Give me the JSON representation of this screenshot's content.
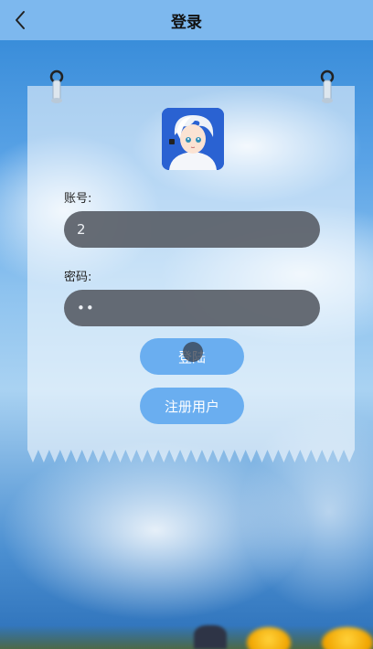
{
  "topbar": {
    "title": "登录",
    "back_icon": "chevron-left-icon",
    "background": "#7db8ee"
  },
  "form": {
    "account_label": "账号:",
    "account_value": "2",
    "password_label": "密码:",
    "password_value": "••"
  },
  "buttons": {
    "login_label": "登陆",
    "register_label": "注册用户",
    "color": "#6aaef0"
  },
  "avatar": {
    "icon": "anime-avatar-icon"
  }
}
